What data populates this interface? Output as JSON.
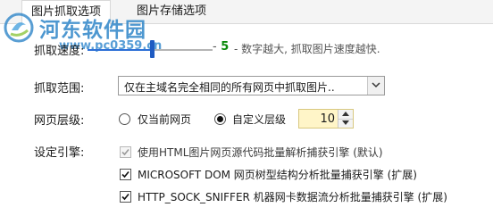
{
  "tabs": [
    {
      "label": "图片抓取选项",
      "active": true
    },
    {
      "label": "图片存储选项",
      "active": false
    }
  ],
  "watermark": {
    "title": "河东软件园",
    "url": "www.pc0359.cn"
  },
  "speed": {
    "label": "抓取速度:",
    "value": "5",
    "value_prefix": "-",
    "hint": "- 数字越大, 抓取图片速度越快.",
    "level_fraction": 0.5
  },
  "scope": {
    "label": "抓取范围:",
    "selected": "仅在主域名完全相同的所有网页中抓取图片.."
  },
  "depth": {
    "label": "网页层级:",
    "options": [
      {
        "label": "仅当前网页",
        "checked": false
      },
      {
        "label": "自定义层级",
        "checked": true
      }
    ],
    "value": "10"
  },
  "engine": {
    "label": "设定引擎:",
    "options": [
      {
        "label": "使用HTML图片网页源代码批量解析捕获引擎 (默认)",
        "checked": true,
        "disabled": true
      },
      {
        "label": "MICROSOFT DOM 网页树型结构分析批量捕获引擎 (扩展)",
        "checked": true,
        "disabled": false
      },
      {
        "label": "HTTP_SOCK_SNIFFER 机器网卡数据流分析批量捕获引擎 (扩展)",
        "checked": true,
        "disabled": false
      }
    ]
  },
  "colors": {
    "accent": "#2d6fd6",
    "value_green": "#0a8a0a",
    "spin_bg": "#fff5c8"
  }
}
